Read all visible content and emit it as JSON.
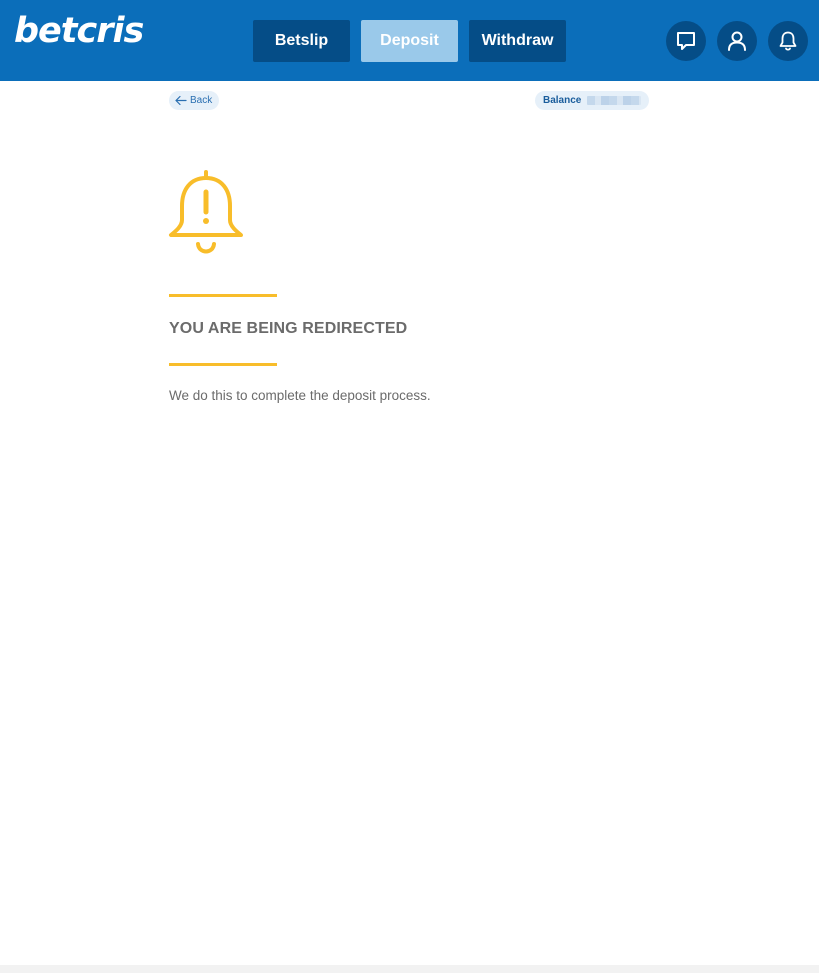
{
  "header": {
    "logo_text": "betcris",
    "nav": {
      "betslip_label": "Betslip",
      "deposit_label": "Deposit",
      "withdraw_label": "Withdraw"
    },
    "icons": [
      "chat-icon",
      "user-icon",
      "bell-icon"
    ]
  },
  "subheader": {
    "back_label": "Back",
    "balance_label": "Balance"
  },
  "main": {
    "icon": "bell-warning-icon",
    "title": "YOU ARE BEING REDIRECTED",
    "message": "We do this to complete the deposit process."
  },
  "colors": {
    "brand_blue": "#0b6eba",
    "dark_blue": "#054d87",
    "active_tab": "#9ac9ea",
    "accent_yellow": "#f8bd2a",
    "text_gray": "#6b6b6b"
  }
}
